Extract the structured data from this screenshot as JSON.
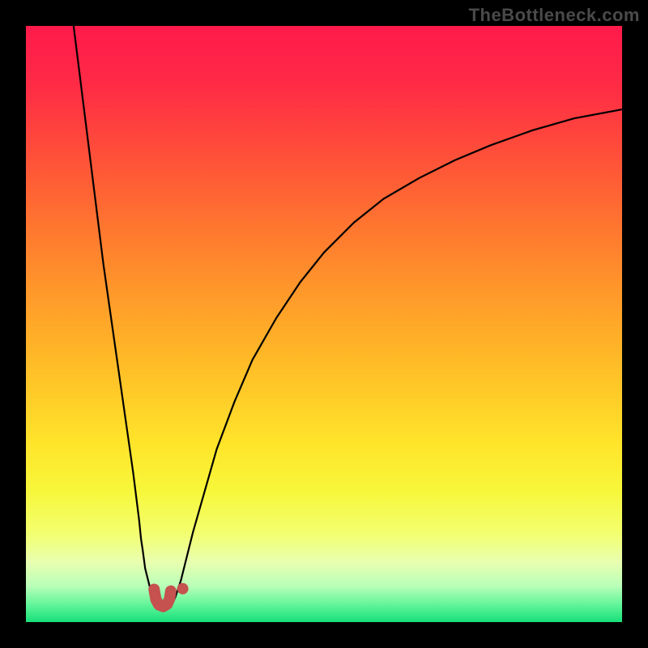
{
  "watermark": {
    "text": "TheBottleneck.com"
  },
  "chart_data": {
    "type": "line",
    "title": "",
    "xlabel": "",
    "ylabel": "",
    "x_range": [
      0,
      100
    ],
    "y_range": [
      0,
      100
    ],
    "gradient_stops": [
      {
        "offset": 0,
        "color": "#ff1a4b"
      },
      {
        "offset": 0.1,
        "color": "#ff2b45"
      },
      {
        "offset": 0.25,
        "color": "#ff5a36"
      },
      {
        "offset": 0.4,
        "color": "#ff8a2c"
      },
      {
        "offset": 0.55,
        "color": "#ffb727"
      },
      {
        "offset": 0.7,
        "color": "#ffe42a"
      },
      {
        "offset": 0.78,
        "color": "#f7f73a"
      },
      {
        "offset": 0.85,
        "color": "#f3ff6e"
      },
      {
        "offset": 0.9,
        "color": "#e8ffb0"
      },
      {
        "offset": 0.94,
        "color": "#b8ffb8"
      },
      {
        "offset": 0.97,
        "color": "#64f59a"
      },
      {
        "offset": 1.0,
        "color": "#17e07a"
      }
    ],
    "series": [
      {
        "name": "left-branch",
        "type": "line",
        "color": "#000000",
        "width": 2.2,
        "x": [
          8,
          9,
          10,
          11,
          12,
          13,
          14,
          15,
          16,
          17,
          18,
          18.5,
          19,
          19.3,
          19.6,
          20,
          20.5,
          21,
          21.5,
          22,
          22.5
        ],
        "y": [
          100,
          92,
          84,
          76,
          68,
          60,
          53,
          46,
          39,
          32,
          25,
          21,
          17,
          14,
          12,
          9,
          7,
          5,
          4,
          3.2,
          3
        ]
      },
      {
        "name": "right-branch",
        "type": "line",
        "color": "#000000",
        "width": 2.2,
        "x": [
          24.5,
          25,
          26,
          27,
          28,
          30,
          32,
          35,
          38,
          42,
          46,
          50,
          55,
          60,
          66,
          72,
          78,
          85,
          92,
          100
        ],
        "y": [
          3,
          4,
          7,
          11,
          15,
          22,
          29,
          37,
          44,
          51,
          57,
          62,
          67,
          71,
          74.5,
          77.5,
          80,
          82.5,
          84.5,
          86
        ]
      },
      {
        "name": "valley-highlight",
        "type": "line",
        "color": "#c5524f",
        "width": 14,
        "linecap": "round",
        "x": [
          21.5,
          21.8,
          22.3,
          23.0,
          23.7,
          24.1,
          24.3
        ],
        "y": [
          5.5,
          3.8,
          2.9,
          2.6,
          3.0,
          3.9,
          5.2
        ]
      }
    ],
    "dots": [
      {
        "name": "valley-dot",
        "x": 26.3,
        "y": 5.6,
        "r": 7,
        "color": "#c5524f"
      }
    ]
  }
}
